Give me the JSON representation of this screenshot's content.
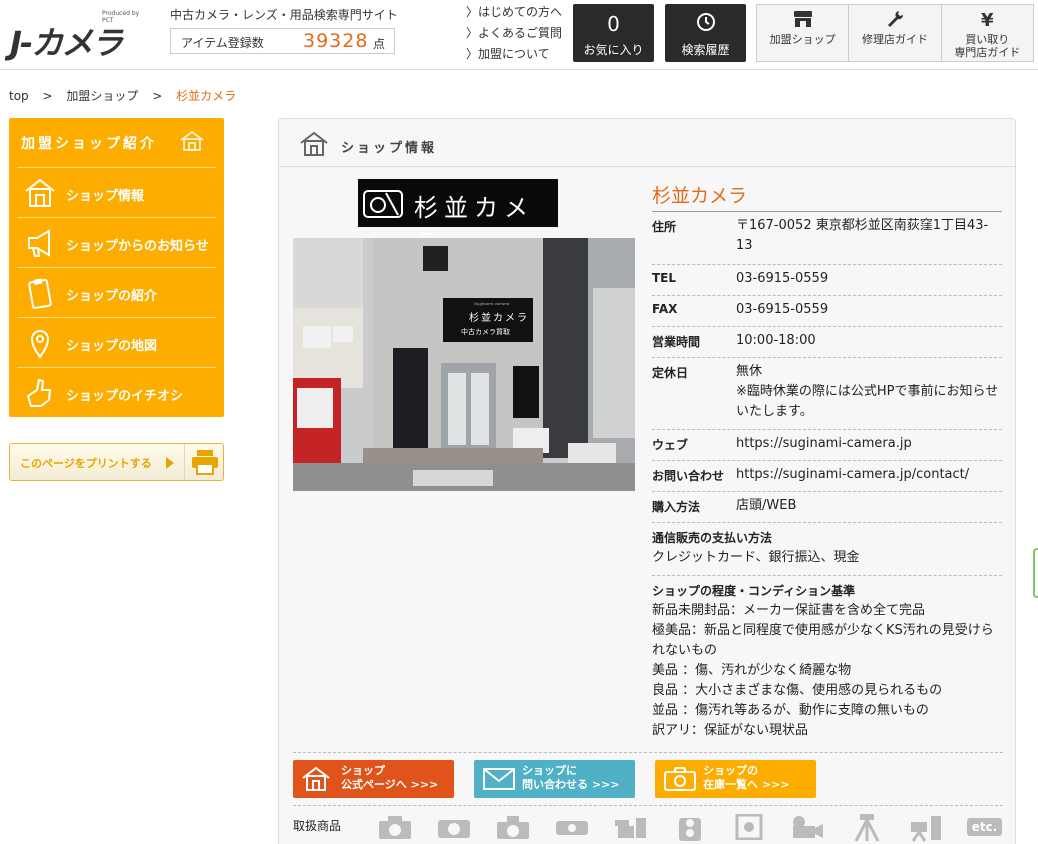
{
  "header": {
    "logo_produced": "Produced by PCT",
    "logo_text": "J-カメラ",
    "site_desc": "中古カメラ・レンズ・用品検索専門サイト",
    "count_label": "アイテム登録数",
    "count_value": "39328",
    "count_unit": "点",
    "links": [
      "はじめての方へ",
      "よくあるご質問",
      "加盟について"
    ],
    "favorites_count": "0",
    "favorites_label": "お気に入り",
    "history_label": "検索履歴",
    "member_shop_label": "加盟ショップ",
    "repair_label": "修理店ガイド",
    "buy_label_1": "買い取り",
    "buy_label_2": "専門店ガイド"
  },
  "breadcrumb": [
    "top",
    "加盟ショップ",
    "杉並カメラ"
  ],
  "breadcrumb_sep": ">",
  "sidebar": {
    "title": "加盟ショップ紹介",
    "items": [
      {
        "label": "ショップ情報",
        "icon": "house-icon"
      },
      {
        "label": "ショップからのお知らせ",
        "icon": "megaphone-icon"
      },
      {
        "label": "ショップの紹介",
        "icon": "clipboard-icon"
      },
      {
        "label": "ショップの地図",
        "icon": "map-pin-icon"
      },
      {
        "label": "ショップのイチオシ",
        "icon": "thumbs-up-icon"
      }
    ],
    "print_label": "このページをプリントする"
  },
  "panel": {
    "title": "ショップ情報",
    "logo_text": "杉並カメラ",
    "sign_small": "Suginami camera",
    "sign_main": "杉並カメラ",
    "sign_sub": "中古カメラ買取",
    "shop_name": "杉並カメラ",
    "rows": {
      "address": {
        "k": "住所",
        "v": "〒167-0052 東京都杉並区南荻窪1丁目43-13"
      },
      "tel": {
        "k": "TEL",
        "v": "03-6915-0559"
      },
      "fax": {
        "k": "FAX",
        "v": "03-6915-0559"
      },
      "hours": {
        "k": "営業時間",
        "v": "10:00-18:00"
      },
      "closed": {
        "k": "定休日",
        "v1": "無休",
        "v2": "※臨時休業の際には公式HPで事前にお知らせいたします。"
      },
      "web": {
        "k": "ウェブ",
        "v": "https://suginami-camera.jp"
      },
      "contact": {
        "k": "お問い合わせ",
        "v": "https://suginami-camera.jp/contact/"
      },
      "purchase": {
        "k": "購入方法",
        "v": "店頭/WEB"
      },
      "payment": {
        "k": "通信販売の支払い方法",
        "v": "クレジットカード、銀行振込、現金"
      },
      "condition": {
        "k": "ショップの程度・コンディション基準",
        "lines": [
          "新品未開封品：メーカー保証書を含め全て完品",
          "極美品：新品と同程度で使用感が少なくKS汚れの見受けられないもの",
          "美品 ：傷、汚れが少なく綺麗な物",
          "良品 ：大小さまざまな傷、使用感の見られるもの",
          "並品 ：傷汚れ等あるが、動作に支障の無いもの",
          "訳アリ：保証がない現状品"
        ]
      }
    },
    "cta": [
      {
        "l1": "ショップ",
        "l2": "公式ページへ >>>",
        "color": "#e0541b"
      },
      {
        "l1": "ショップに",
        "l2": "問い合わせる >>>",
        "color": "#4fb0c6"
      },
      {
        "l1": "ショップの",
        "l2": "在庫一覧へ >>>",
        "color": "#fcad00"
      }
    ],
    "handling_label": "取扱商品",
    "handling_etc": "etc."
  },
  "colors": {
    "accent": "#e36b17",
    "sidebar": "#fcad00",
    "dark": "#2a2a2a"
  }
}
